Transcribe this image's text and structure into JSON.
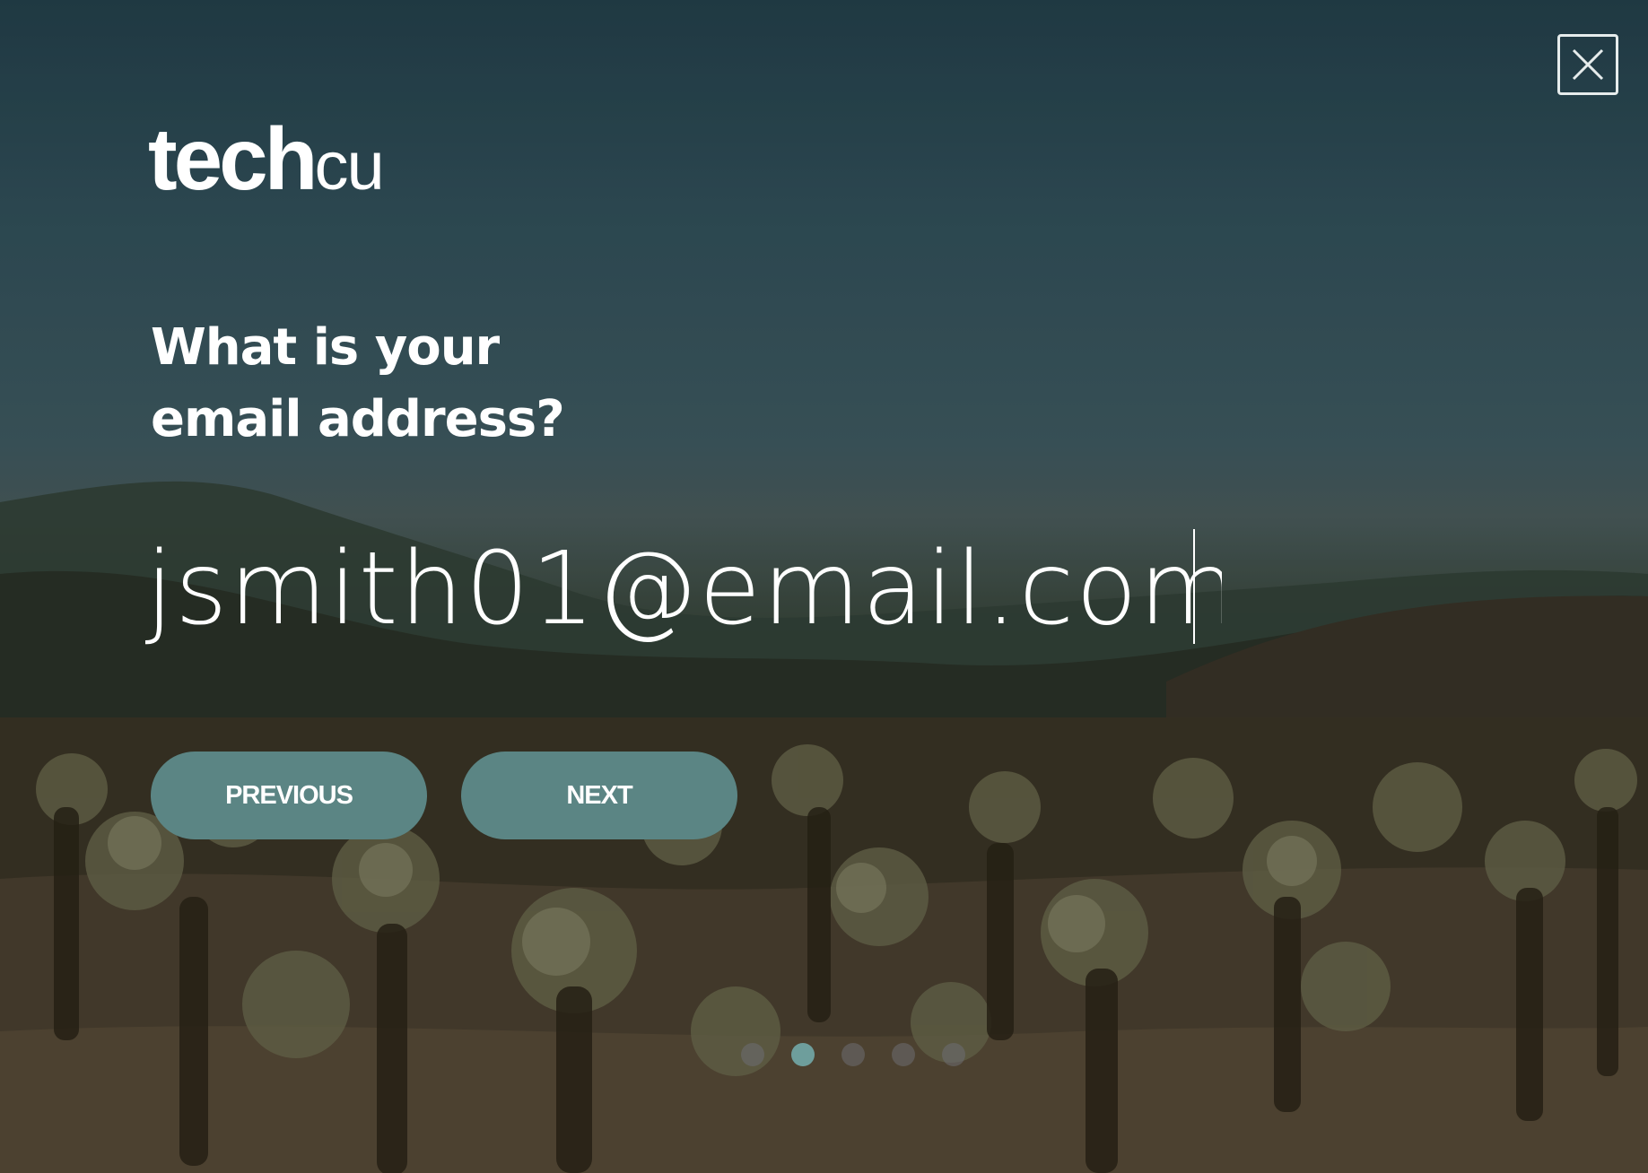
{
  "brand": {
    "logo_bold": "tech",
    "logo_light": "cu"
  },
  "form": {
    "question_line1": "What is your",
    "question_line2": "email address?",
    "email_value": "jsmith01@email.com"
  },
  "buttons": {
    "previous_label": "PREVIOUS",
    "next_label": "NEXT"
  },
  "pagination": {
    "total_steps": 5,
    "current_step": 2
  },
  "icons": {
    "close": "close-icon"
  },
  "colors": {
    "button": "#5b8584",
    "active_dot": "#6e9e9c",
    "text": "#ffffff"
  }
}
